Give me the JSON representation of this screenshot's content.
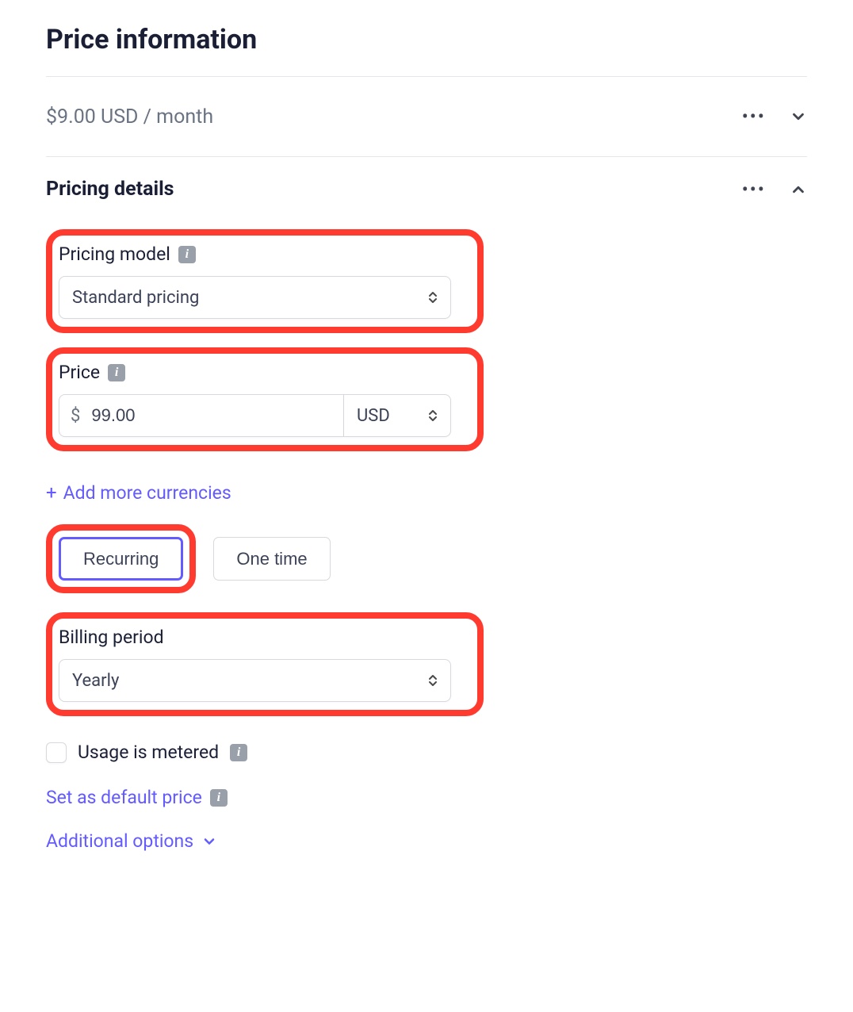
{
  "header": {
    "title": "Price information"
  },
  "existingPrice": {
    "display": "$9.00 USD / month"
  },
  "details": {
    "title": "Pricing details",
    "pricingModel": {
      "label": "Pricing model",
      "value": "Standard pricing"
    },
    "price": {
      "label": "Price",
      "symbol": "$",
      "amount": "99.00",
      "currency": "USD"
    },
    "addCurrencies": "Add more currencies",
    "typeToggle": {
      "recurring": "Recurring",
      "oneTime": "One time"
    },
    "billingPeriod": {
      "label": "Billing period",
      "value": "Yearly"
    },
    "metered": {
      "label": "Usage is metered",
      "checked": false
    },
    "setDefault": "Set as default price",
    "additional": "Additional options"
  }
}
